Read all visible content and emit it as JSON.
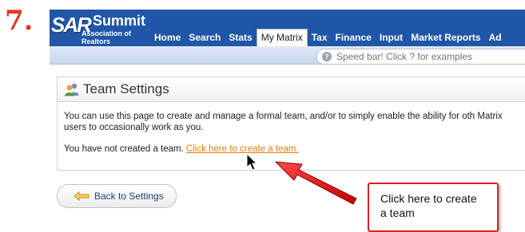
{
  "step_number": "7.",
  "logo": {
    "mark": "SAR",
    "name": "Summit",
    "subtitle": "Association of Realtors"
  },
  "nav": {
    "items": [
      {
        "label": "Home"
      },
      {
        "label": "Search"
      },
      {
        "label": "Stats"
      },
      {
        "label": "My Matrix"
      },
      {
        "label": "Tax"
      },
      {
        "label": "Finance"
      },
      {
        "label": "Input"
      },
      {
        "label": "Market Reports"
      },
      {
        "label": "Ad"
      }
    ],
    "active": "My Matrix"
  },
  "speedbar": {
    "placeholder": "Speed bar! Click ? for examples"
  },
  "panel": {
    "title": "Team Settings",
    "description": "You can use this page to create and manage a formal team, and/or to simply enable the ability for oth Matrix users to occasionally work as you.",
    "status_text": "You have not created a team.",
    "create_link": "Click here to create a team."
  },
  "back_button": {
    "label": "Back to Settings"
  },
  "callout": {
    "text": "Click here to create a team"
  },
  "colors": {
    "nav_bg": "#1f56a7",
    "step_number": "#e03a1e",
    "link": "#e07b10",
    "annotation_red": "#e02020"
  }
}
